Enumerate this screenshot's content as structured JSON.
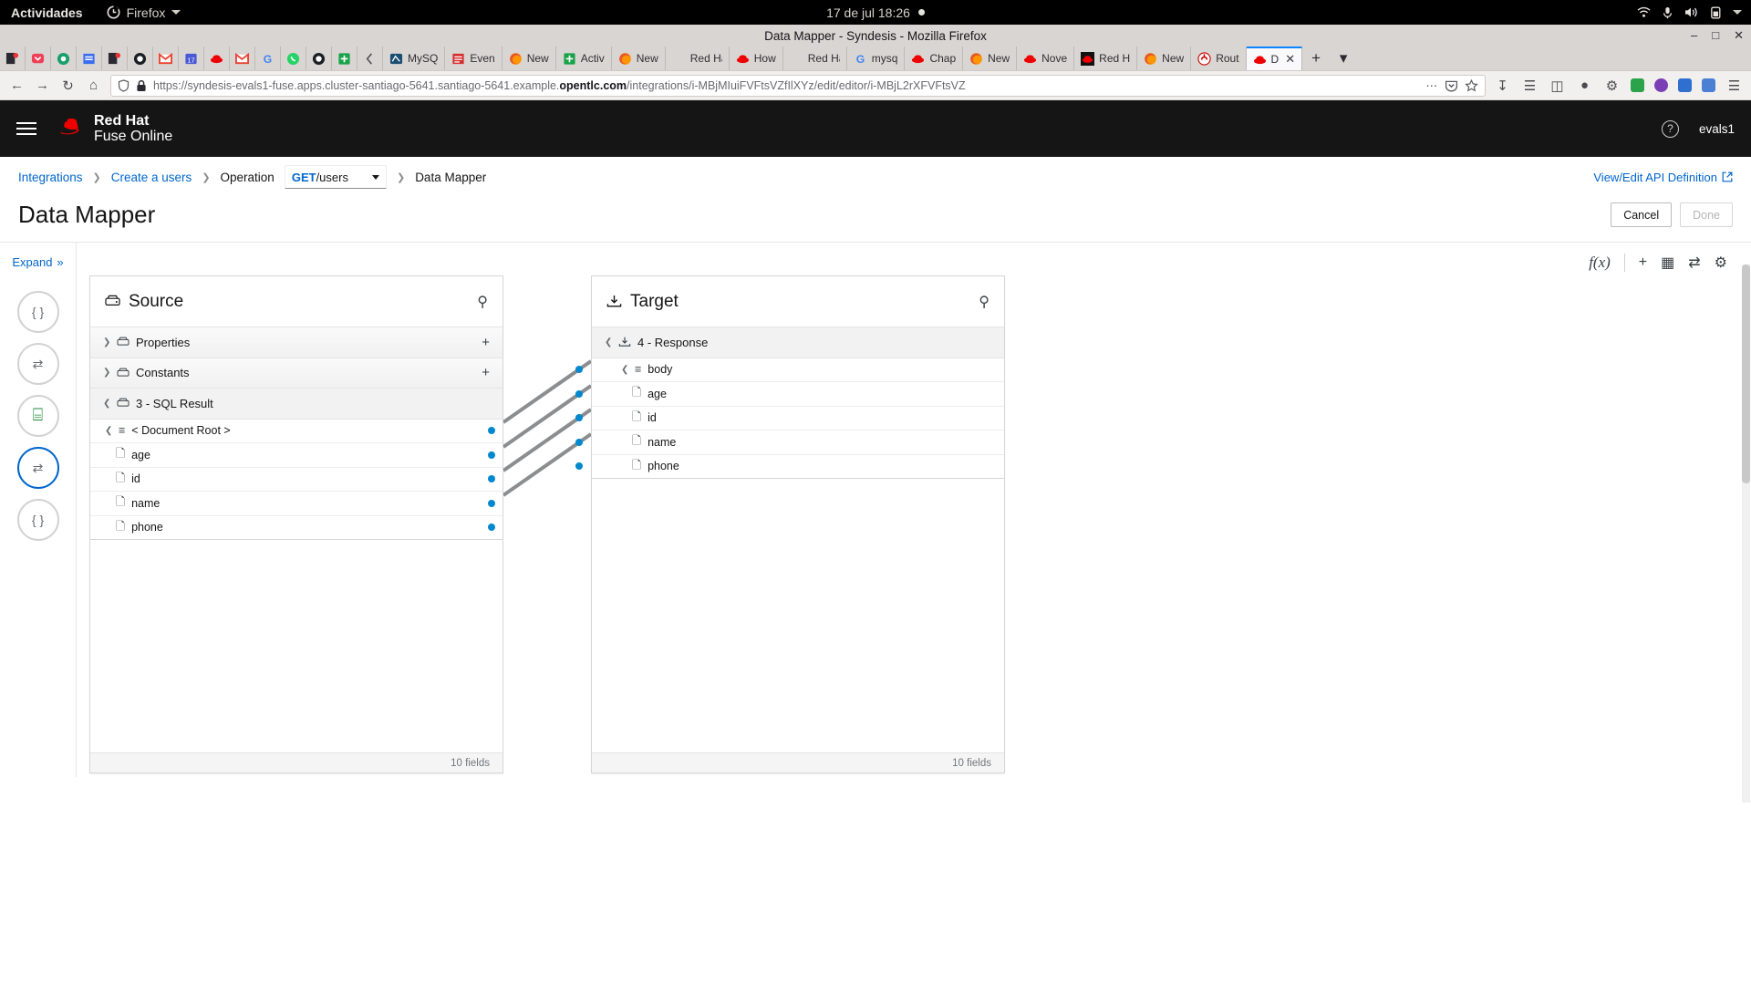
{
  "gnome": {
    "activities": "Actividades",
    "app_name": "Firefox",
    "clock": "17 de jul  18:26",
    "icons": [
      "wifi-icon",
      "microphone-icon",
      "volume-icon",
      "battery-icon",
      "chevron-down-icon"
    ]
  },
  "browser": {
    "window_title": "Data Mapper - Syndesis - Mozilla Firefox",
    "window_buttons": [
      "minimize-button",
      "maximize-button",
      "close-button"
    ],
    "tabs": [
      {
        "label": "",
        "icon": "contact-icon"
      },
      {
        "label": "",
        "icon": "pocket-icon"
      },
      {
        "label": "",
        "icon": "at-icon"
      },
      {
        "label": "",
        "icon": "doc-icon"
      },
      {
        "label": "",
        "icon": "contact-icon"
      },
      {
        "label": "",
        "icon": "github-icon"
      },
      {
        "label": "",
        "icon": "gmail-icon"
      },
      {
        "label": "",
        "icon": "calendar-icon"
      },
      {
        "label": "",
        "icon": "redhat-icon"
      },
      {
        "label": "",
        "icon": "gmail-icon"
      },
      {
        "label": "",
        "icon": "google-icon"
      },
      {
        "label": "",
        "icon": "whatsapp-icon"
      },
      {
        "label": "",
        "icon": "github-icon"
      },
      {
        "label": "",
        "icon": "sheets-icon"
      },
      {
        "label": "",
        "icon": "back-icon"
      },
      {
        "label": "MySQ",
        "icon": "mysql-icon"
      },
      {
        "label": "Even",
        "icon": "event-icon"
      },
      {
        "label": "New",
        "icon": "firefox-icon"
      },
      {
        "label": "Activ",
        "icon": "sheets-icon"
      },
      {
        "label": "New",
        "icon": "firefox-icon"
      },
      {
        "label": "Red Hat",
        "icon": "blank-icon"
      },
      {
        "label": "How",
        "icon": "redhat-icon"
      },
      {
        "label": "Red Hat",
        "icon": "blank-icon"
      },
      {
        "label": "mysq",
        "icon": "google-icon"
      },
      {
        "label": "Chap",
        "icon": "redhat-icon"
      },
      {
        "label": "New",
        "icon": "firefox-icon"
      },
      {
        "label": "Nove",
        "icon": "redhat-icon"
      },
      {
        "label": "Red H",
        "icon": "redhat-dark-icon"
      },
      {
        "label": "New",
        "icon": "firefox-icon"
      },
      {
        "label": "Rout",
        "icon": "router-icon"
      },
      {
        "label": "D",
        "icon": "redhat-icon",
        "active": true
      }
    ],
    "new_tab_label": "+",
    "tab_list_label": "▾",
    "url_prefix": "https://syndesis-evals1-fuse.apps.cluster-santiago-5641.santiago-5641.example.",
    "url_domain": "opentlc.com",
    "url_suffix": "/integrations/i-MBjMIuiFVFtsVZfIlXYz/edit/editor/i-MBjL2rXFVFtsVZ",
    "nav_icons": [
      "back-icon",
      "forward-icon",
      "reload-icon",
      "home-icon"
    ],
    "url_icons": [
      "shield-icon",
      "lock-icon"
    ],
    "url_end_icons": [
      "page-actions-icon",
      "pocket-save-icon",
      "bookmark-star-icon"
    ],
    "toolbar_icons": [
      "downloads-icon",
      "library-icon",
      "sidebar-icon",
      "account-icon",
      "container-icon"
    ]
  },
  "app": {
    "brand_line1": "Red Hat",
    "brand_line2": "Fuse Online",
    "help_label": "?",
    "user": "evals1"
  },
  "breadcrumb": {
    "items": [
      {
        "label": "Integrations",
        "link": true
      },
      {
        "label": "Create a users",
        "link": true
      },
      {
        "label": "Operation",
        "link": false
      }
    ],
    "operation_method": "GET",
    "operation_path": "/users",
    "current": "Data Mapper",
    "api_definition_link": "View/Edit API Definition"
  },
  "page": {
    "title": "Data Mapper",
    "cancel_label": "Cancel",
    "done_label": "Done"
  },
  "mapper": {
    "expand_label": "Expand",
    "expand_chevron": "»",
    "steps": [
      {
        "name": "step-api-provider",
        "glyph": "{ }",
        "active": false
      },
      {
        "name": "step-data-mapper-1",
        "glyph": "⇄",
        "active": false
      },
      {
        "name": "step-database",
        "glyph": "⌸",
        "active": false
      },
      {
        "name": "step-data-mapper-2",
        "glyph": "⇄",
        "active": true
      },
      {
        "name": "step-api-response",
        "glyph": "{ }",
        "active": false
      }
    ],
    "toolbar": [
      {
        "name": "expression-button",
        "glyph": "f(x)"
      },
      {
        "name": "add-mapping-button",
        "glyph": "+"
      },
      {
        "name": "mapping-table-button",
        "glyph": "▦"
      },
      {
        "name": "mapping-details-button",
        "glyph": "⇄"
      },
      {
        "name": "settings-button",
        "glyph": "⚙"
      }
    ],
    "source": {
      "title": "Source",
      "title_icon": "source-document-icon",
      "search_icon": "search-icon",
      "groups": [
        {
          "label": "Properties",
          "expanded": false,
          "add": "+"
        },
        {
          "label": "Constants",
          "expanded": false,
          "add": "+"
        },
        {
          "label": "3 - SQL Result",
          "expanded": true
        }
      ],
      "root": "< Document Root >",
      "fields": [
        "age",
        "id",
        "name",
        "phone"
      ],
      "footer": "10 fields"
    },
    "target": {
      "title": "Target",
      "title_icon": "target-document-icon",
      "search_icon": "search-icon",
      "groups": [
        {
          "label": "4 - Response",
          "expanded": true
        }
      ],
      "root": "body",
      "fields": [
        "age",
        "id",
        "name",
        "phone"
      ],
      "footer": "10 fields"
    },
    "colors": {
      "accent": "#0066cc",
      "connector_dot": "#0088ce",
      "connector_line": "#8b8d8f"
    }
  }
}
